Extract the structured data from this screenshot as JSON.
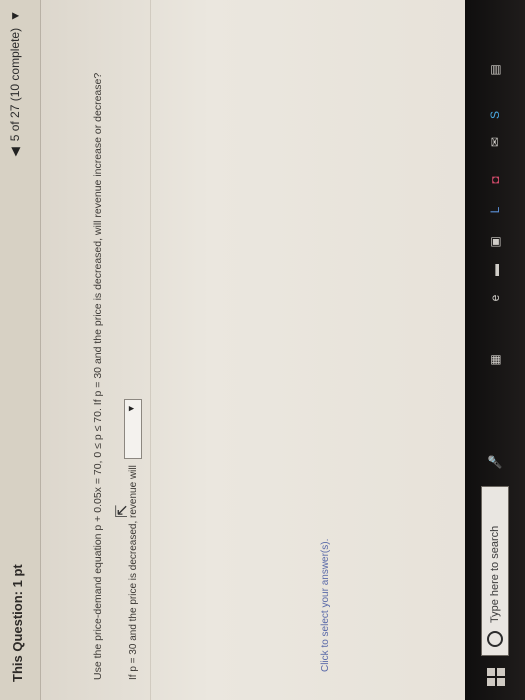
{
  "header": {
    "question_label": "This Question: 1 pt",
    "progress": "5 of 27 (10 complete)"
  },
  "question": {
    "text": "Use the price-demand equation p + 0.05x = 70, 0 ≤ p ≤ 70. If p = 30 and the price is decreased, will revenue increase or decrease?",
    "prompt": "If p = 30 and the price is decreased, revenue will",
    "hint": "Click to select your answer(s)."
  },
  "taskbar": {
    "search_placeholder": "Type here to search"
  }
}
